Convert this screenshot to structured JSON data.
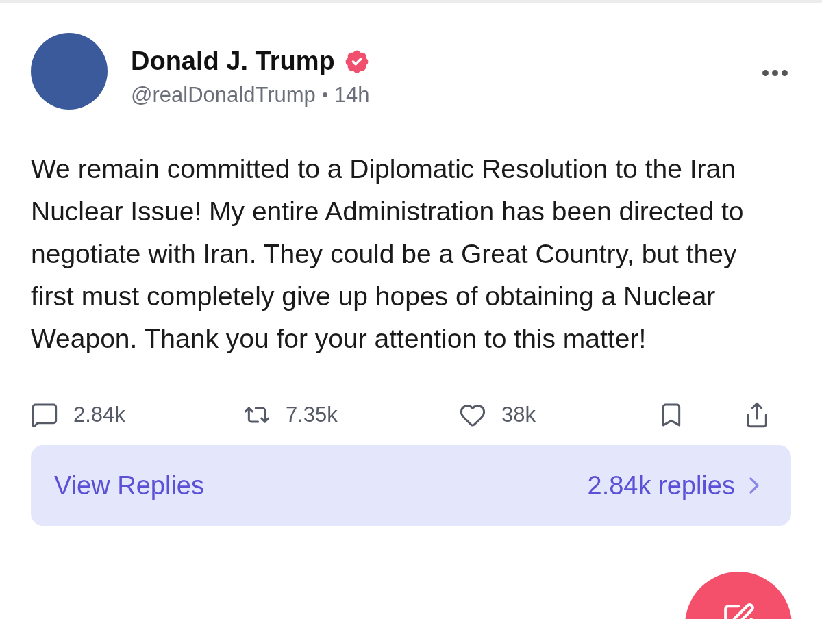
{
  "post": {
    "author": {
      "name": "Donald J. Trump",
      "verified": true,
      "handle": "@realDonaldTrump",
      "time": "14h"
    },
    "text": "We remain committed to a Diplomatic Resolution to the Iran Nuclear Issue! My entire Administration has been directed to negotiate with Iran. They could be a Great Country, but they first must completely give up hopes of obtaining a Nuclear Weapon. Thank you for your attention to this matter!",
    "actions": [
      {
        "kind": "reply",
        "count": "2.84k"
      },
      {
        "kind": "repost",
        "count": "7.35k"
      },
      {
        "kind": "like",
        "count": "38k"
      },
      {
        "kind": "bookmark"
      },
      {
        "kind": "share"
      }
    ],
    "view_replies": {
      "label": "View Replies",
      "count": "2.84k replies"
    }
  }
}
